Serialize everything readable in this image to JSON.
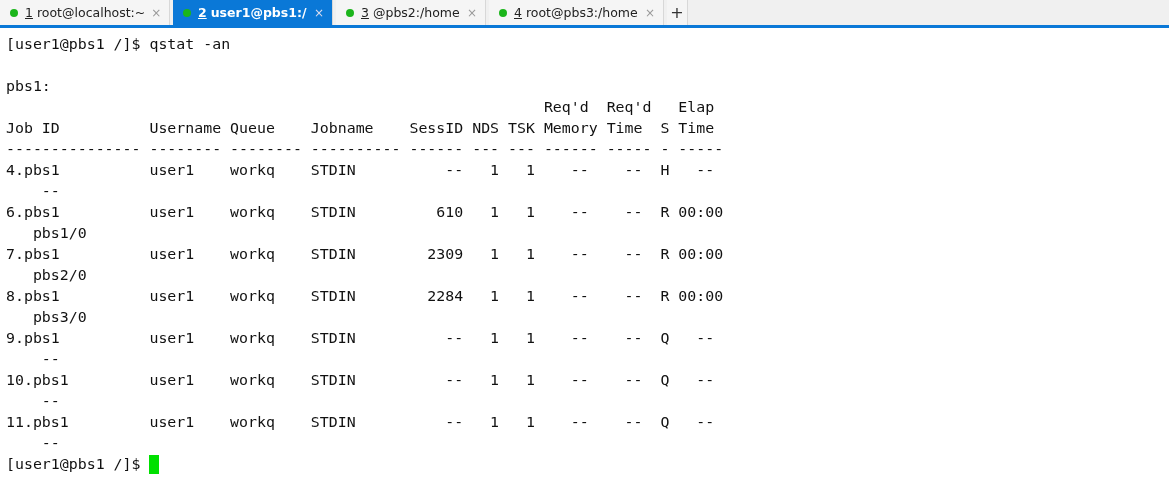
{
  "tabs": [
    {
      "number": "1",
      "label": "root@localhost:~",
      "selected": false,
      "close": "×"
    },
    {
      "number": "2",
      "label": "user1@pbs1:/",
      "selected": true,
      "close": "×"
    },
    {
      "number": "3",
      "label": "@pbs2:/home",
      "selected": false,
      "close": "×"
    },
    {
      "number": "4",
      "label": "root@pbs3:/home",
      "selected": false,
      "close": "×"
    }
  ],
  "new_tab": "+",
  "terminal": {
    "command": "[user1@pbs1 /]$ qstat -an",
    "lines": [
      "pbs1:",
      "                                                            Req'd  Req'd   Elap",
      "Job ID          Username Queue    Jobname    SessID NDS TSK Memory Time  S Time",
      "--------------- -------- -------- ---------- ------ --- --- ------ ----- - -----",
      "4.pbs1          user1    workq    STDIN          --   1   1    --    --  H   --",
      "    --",
      "6.pbs1          user1    workq    STDIN         610   1   1    --    --  R 00:00",
      "   pbs1/0",
      "7.pbs1          user1    workq    STDIN        2309   1   1    --    --  R 00:00",
      "   pbs2/0",
      "8.pbs1          user1    workq    STDIN        2284   1   1    --    --  R 00:00",
      "   pbs3/0",
      "9.pbs1          user1    workq    STDIN          --   1   1    --    --  Q   --",
      "    --",
      "10.pbs1         user1    workq    STDIN          --   1   1    --    --  Q   --",
      "    --",
      "11.pbs1         user1    workq    STDIN          --   1   1    --    --  Q   --",
      "    --"
    ],
    "prompt": "[user1@pbs1 /]$ ",
    "cursor": true
  }
}
